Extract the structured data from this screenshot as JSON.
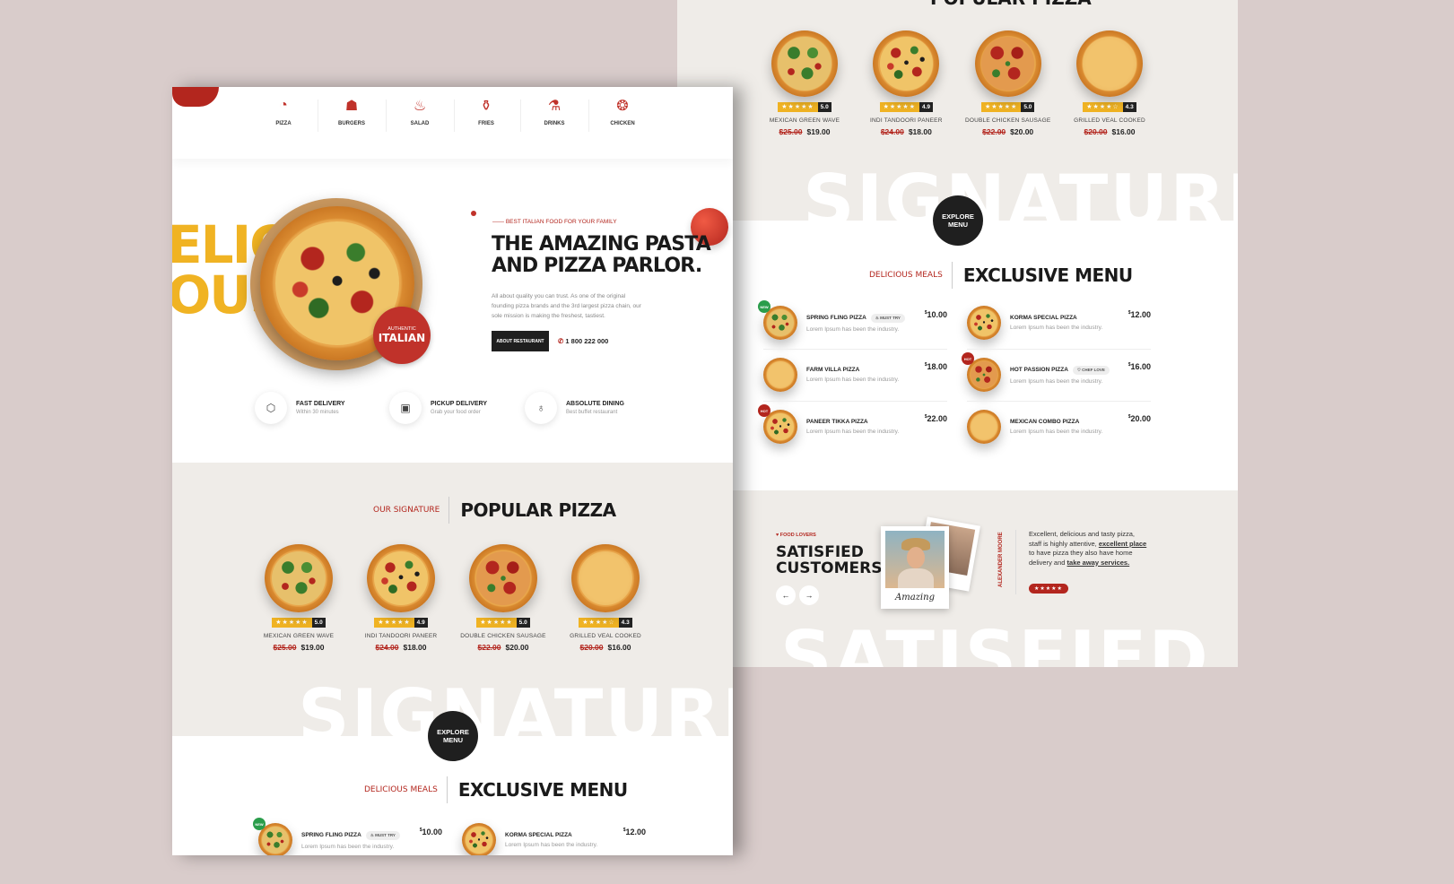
{
  "categories": [
    {
      "label": "PIZZA",
      "icon": "pizza-icon"
    },
    {
      "label": "BURGERS",
      "icon": "burger-icon"
    },
    {
      "label": "SALAD",
      "icon": "salad-icon"
    },
    {
      "label": "FRIES",
      "icon": "fries-icon"
    },
    {
      "label": "DRINKS",
      "icon": "drinks-icon"
    },
    {
      "label": "CHICKEN",
      "icon": "chicken-icon"
    }
  ],
  "hero": {
    "big_word_1": "ELIC",
    "big_word_2": "OUS",
    "seal_top": "AUTHENTIC",
    "seal_main": "ITALIAN",
    "kicker": "BEST ITALIAN FOOD FOR YOUR FAMILY",
    "title_line1": "THE AMAZING PASTA",
    "title_line2": "AND PIZZA PARLOR.",
    "desc_line1": "All about quality you can trust. As one of the original",
    "desc_line2": "founding pizza brands and the 3rd largest pizza chain, our",
    "desc_line3": "sole mission is making the freshest, tastiest.",
    "cta": "ABOUT RESTAURANT",
    "phone": "1 800 222 000"
  },
  "features": [
    {
      "title": "FAST DELIVERY",
      "sub": "Within 30 minutes",
      "icon": "box-icon"
    },
    {
      "title": "PICKUP DELIVERY",
      "sub": "Grab your food order",
      "icon": "bag-icon"
    },
    {
      "title": "ABSOLUTE DINING",
      "sub": "Best buffet restaurant",
      "icon": "bulb-icon"
    }
  ],
  "popular": {
    "sub": "OUR SIGNATURE",
    "title": "POPULAR PIZZA",
    "back_title": "POPULAR PIZZA",
    "items": [
      {
        "name": "MEXICAN GREEN WAVE",
        "old": "$25.00",
        "new": "$19.00",
        "stars": "★★★★★",
        "score": "5.0"
      },
      {
        "name": "INDI TANDOORI PANEER",
        "old": "$24.00",
        "new": "$18.00",
        "stars": "★★★★★",
        "score": "4.9"
      },
      {
        "name": "DOUBLE CHICKEN SAUSAGE",
        "old": "$22.00",
        "new": "$20.00",
        "stars": "★★★★★",
        "score": "5.0"
      },
      {
        "name": "GRILLED VEAL COOKED",
        "old": "$20.00",
        "new": "$16.00",
        "stars": "★★★★☆",
        "score": "4.3"
      }
    ]
  },
  "signature_word": "SIGNATURE",
  "explore": {
    "line1": "EXPLORE",
    "line2": "MENU"
  },
  "exclusive": {
    "sub": "DELICIOUS MEALS",
    "title": "EXCLUSIVE MENU",
    "desc": "Lorem Ipsum has been the industry.",
    "items": [
      {
        "name": "SPRING FLING PIZZA",
        "price": "10.00",
        "tag": "♨ MUST TRY",
        "badge": "NEW"
      },
      {
        "name": "KORMA SPECIAL PIZZA",
        "price": "12.00",
        "tag": "",
        "badge": ""
      },
      {
        "name": "FARM VILLA PIZZA",
        "price": "18.00",
        "tag": "",
        "badge": ""
      },
      {
        "name": "HOT PASSION PIZZA",
        "price": "16.00",
        "tag": "♡ CHEF LOVE",
        "badge": "HOT"
      },
      {
        "name": "PANEER TIKKA PIZZA",
        "price": "22.00",
        "tag": "",
        "badge": "HOT"
      },
      {
        "name": "MEXICAN COMBO PIZZA",
        "price": "20.00",
        "tag": "",
        "badge": ""
      }
    ]
  },
  "testimonial": {
    "kicker": "FOOD LOVERS",
    "title_line1": "SATISFIED",
    "title_line2": "CUSTOMERS",
    "photo_caption": "Amazing",
    "author": "ALEXANDER MOORE",
    "quote_a": "Excellent, delicious and tasty pizza, staff is highly attentive,",
    "quote_link1": "excellent place",
    "quote_b": "to have pizza they also have home delivery and",
    "quote_link2": "take away services.",
    "stars": "★★★★★",
    "big_word": "SATISFIED",
    "prev": "←",
    "next": "→"
  },
  "colors": {
    "accent": "#b3261e",
    "yellow": "#f0b323",
    "dark": "#1f1f1f",
    "bg": "#d9cccb",
    "section": "#efece8"
  }
}
